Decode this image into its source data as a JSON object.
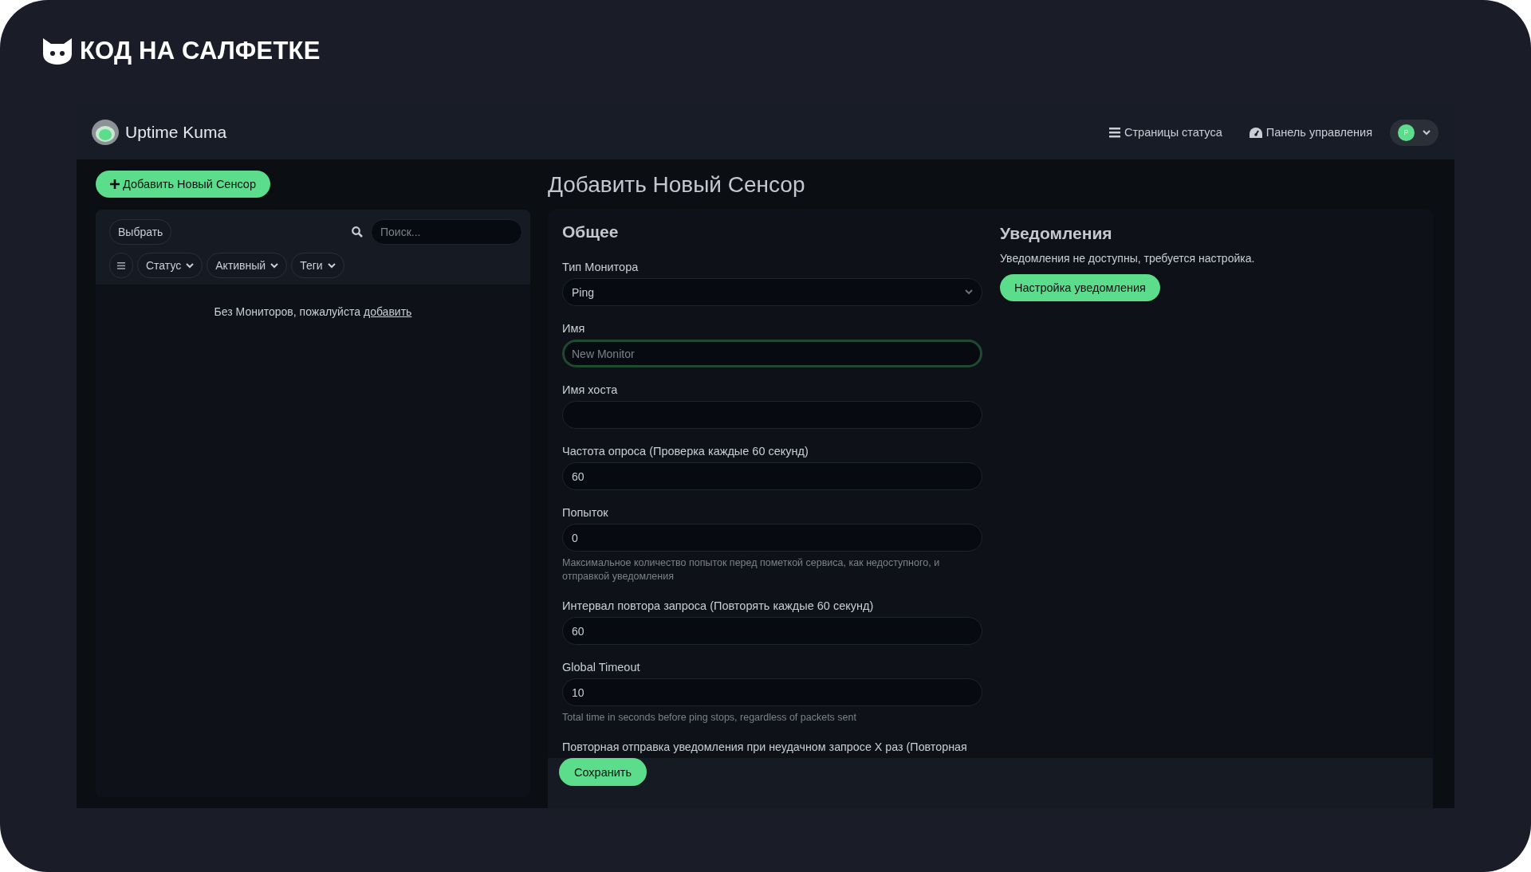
{
  "brand": {
    "name": "КОД НА САЛФЕТКЕ"
  },
  "app": {
    "name": "Uptime Kuma"
  },
  "nav": [
    {
      "label": "Страницы статуса"
    },
    {
      "label": "Панель управления"
    }
  ],
  "user": {
    "initial": "P"
  },
  "sidebar": {
    "add_button": "Добавить Новый Сенсор",
    "select_button": "Выбрать",
    "search": {
      "placeholder": "Поиск..."
    },
    "filters": [
      "Статус",
      "Активный",
      "Теги"
    ],
    "empty_text": "Без Мониторов, пожалуйста",
    "empty_link": "добавить"
  },
  "page_title": "Добавить Новый Сенсор",
  "general": {
    "title": "Общее",
    "fields": [
      {
        "label": "Тип Монитора",
        "kind": "select",
        "value": "Ping",
        "focused": false
      },
      {
        "label": "Имя",
        "kind": "text",
        "placeholder": "New Monitor",
        "focused": true
      },
      {
        "label": "Имя хоста",
        "kind": "text",
        "focused": false
      },
      {
        "label": "Частота опроса (Проверка каждые 60 секунд)",
        "kind": "text",
        "value": "60",
        "focused": false
      },
      {
        "label": "Попыток",
        "kind": "text",
        "value": "0",
        "focused": false,
        "help": "Максимальное количество попыток перед пометкой сервиса, как недоступного, и отправкой уведомления"
      },
      {
        "label": "Интервал повтора запроса (Повторять каждые 60 секунд)",
        "kind": "text",
        "value": "60",
        "focused": false
      },
      {
        "label": "Global Timeout",
        "kind": "text",
        "value": "10",
        "focused": false,
        "help": "Total time in seconds before ping stops, regardless of packets sent"
      }
    ],
    "cut_label": "Повторная отправка уведомления при неудачном запросе X раз (Повторная"
  },
  "notifications": {
    "title": "Уведомления",
    "text": "Уведомления не доступны, требуется настройка.",
    "button": "Настройка уведомления"
  },
  "save_button": "Сохранить"
}
